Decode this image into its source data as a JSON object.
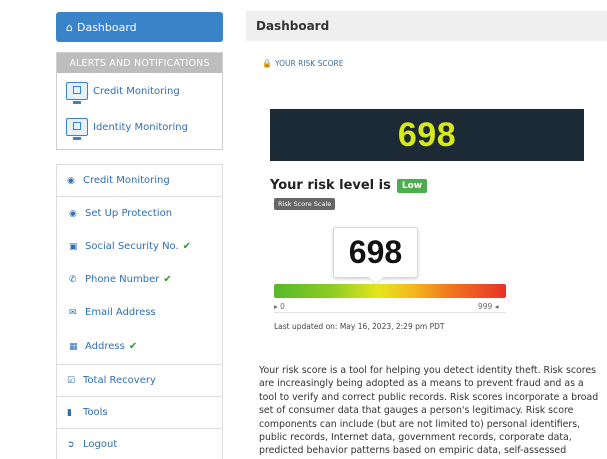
{
  "sidebar": {
    "dashboard_label": "Dashboard",
    "alerts_heading": "ALERTS AND NOTIFICATIONS",
    "alert_items": [
      {
        "label": "Credit Monitoring",
        "icon": "monitor-credit-icon"
      },
      {
        "label": "Identity Monitoring",
        "icon": "monitor-identity-icon"
      }
    ],
    "menu": {
      "credit_monitoring": "Credit Monitoring",
      "set_up_protection": "Set Up Protection",
      "ssn": "Social Security No.",
      "phone": "Phone Number",
      "email": "Email Address",
      "address": "Address",
      "total_recovery": "Total Recovery",
      "tools": "Tools",
      "logout": "Logout"
    }
  },
  "main": {
    "header": "Dashboard",
    "risk_section_label": "YOUR RISK SCORE",
    "score": "698",
    "risk_level_prefix": "Your risk level is",
    "risk_level": "Low",
    "scale_button": "Risk Score Scale",
    "gauge_min": "0",
    "gauge_max": "999",
    "gauge_value_fraction": 0.699,
    "last_updated": "Last updated on: May 16, 2023, 2:29 pm PDT",
    "description": "Your risk score is a tool for helping you detect identity theft. Risk scores are increasingly being adopted as a means to prevent fraud and as a tool to verify and correct public records. Risk scores incorporate a broad set of consumer data that gauges a person's legitimacy. Risk score components can include (but are not limited to) personal identifiers, public records, Internet data, government records, corporate data, predicted behavior patterns based on empiric data, self-assessed"
  },
  "colors": {
    "accent": "#3b83c9",
    "score_panel_bg": "#1c2a36",
    "score_text": "#d8ea1a",
    "low_badge": "#4cae4c",
    "check": "#2c9a2c"
  }
}
